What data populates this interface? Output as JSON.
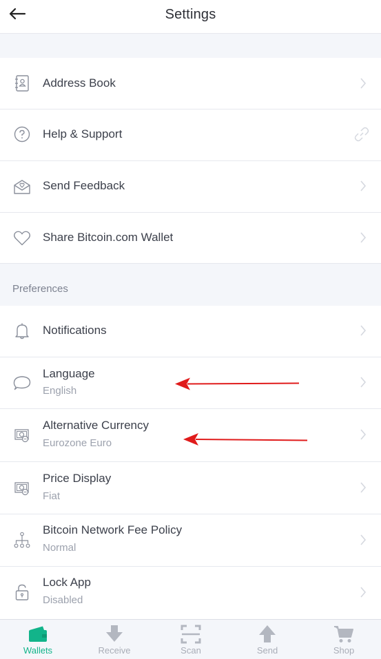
{
  "header": {
    "title": "Settings"
  },
  "rows_top": [
    {
      "label": "Address Book",
      "icon": "address-book-icon"
    },
    {
      "label": "Help & Support",
      "icon": "help-icon",
      "trailing": "link-icon"
    },
    {
      "label": "Send Feedback",
      "icon": "feedback-icon"
    },
    {
      "label": "Share Bitcoin.com Wallet",
      "icon": "heart-icon"
    }
  ],
  "preferences": {
    "heading": "Preferences",
    "items": [
      {
        "label": "Notifications",
        "icon": "bell-icon"
      },
      {
        "label": "Language",
        "value": "English",
        "icon": "chat-bubble-icon"
      },
      {
        "label": "Alternative Currency",
        "value": "Eurozone Euro",
        "icon": "currency-icon"
      },
      {
        "label": "Price Display",
        "value": "Fiat",
        "icon": "price-display-icon"
      },
      {
        "label": "Bitcoin Network Fee Policy",
        "value": "Normal",
        "icon": "network-icon"
      },
      {
        "label": "Lock App",
        "value": "Disabled",
        "icon": "lock-icon"
      }
    ]
  },
  "tabs": [
    {
      "label": "Wallets",
      "active": true,
      "icon": "wallet-icon"
    },
    {
      "label": "Receive",
      "icon": "receive-icon"
    },
    {
      "label": "Scan",
      "icon": "scan-icon"
    },
    {
      "label": "Send",
      "icon": "send-icon"
    },
    {
      "label": "Shop",
      "icon": "cart-icon"
    }
  ],
  "colors": {
    "accent": "#12b48a",
    "annotation": "#e01b1b",
    "muted": "#a9adb7"
  }
}
